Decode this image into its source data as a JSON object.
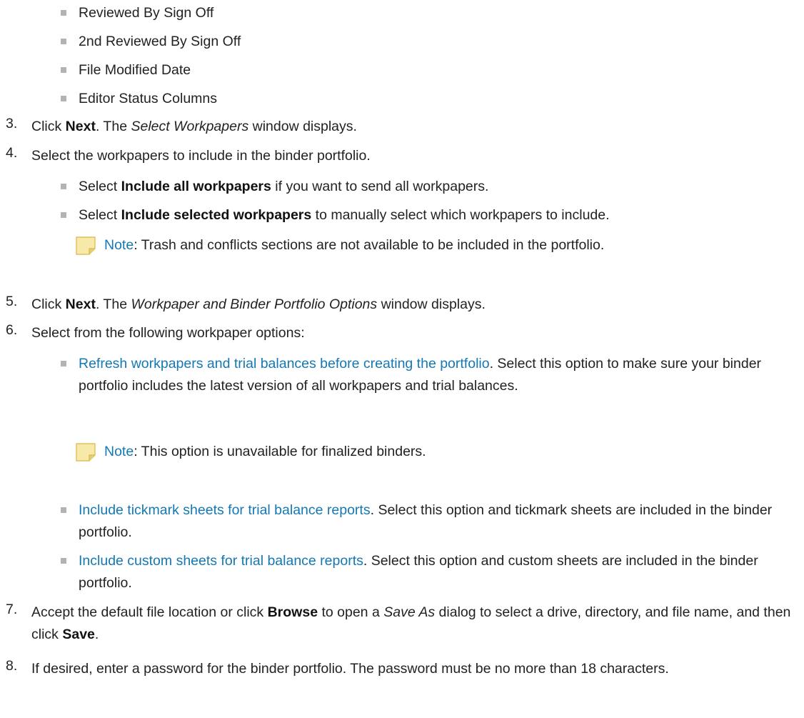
{
  "top_bullets": [
    "Reviewed By Sign Off",
    "2nd Reviewed By Sign Off",
    "File Modified Date",
    "Editor Status Columns"
  ],
  "steps": {
    "s3": {
      "num": "3.",
      "t1": "Click ",
      "b1": "Next",
      "t2": ". The ",
      "i1": "Select Workpapers",
      "t3": " window displays."
    },
    "s4": {
      "num": "4.",
      "text": "Select the workpapers to include in the binder portfolio.",
      "items": [
        {
          "t1": "Select ",
          "b1": "Include all workpapers",
          "t2": " if you want to send all workpapers."
        },
        {
          "t1": "Select ",
          "b1": "Include selected workpapers",
          "t2": " to manually select which workpapers to include."
        }
      ],
      "note": {
        "label": "Note",
        "text": ": Trash and conflicts sections are not available to be included in the portfolio."
      }
    },
    "s5": {
      "num": "5.",
      "t1": "Click ",
      "b1": "Next",
      "t2": ". The ",
      "i1": "Workpaper and Binder Portfolio Options",
      "t3": " window displays."
    },
    "s6": {
      "num": "6.",
      "text": "Select from the following workpaper options:",
      "items": [
        {
          "link": "Refresh workpapers and trial balances before creating the portfolio",
          "text": ". Select this option to make sure your binder portfolio includes the latest version of all workpapers and trial balances."
        },
        {
          "link": "Include tickmark sheets for trial balance reports",
          "text": ". Select this option and tickmark sheets are included in the binder portfolio."
        },
        {
          "link": "Include custom sheets for trial balance reports",
          "text": ". Select this option and custom sheets are included in the binder portfolio."
        }
      ],
      "note": {
        "label": "Note",
        "text": ": This option is unavailable for finalized binders."
      }
    },
    "s7": {
      "num": "7.",
      "t1": "Accept the default file location or click ",
      "b1": "Browse",
      "t2": " to open a ",
      "i1": "Save As",
      "t3": " dialog to select a drive, directory, and file name, and then click ",
      "b2": "Save",
      "t4": "."
    },
    "s8": {
      "num": "8.",
      "text": "If desired, enter a password for the binder portfolio. The password must be no more than 18 characters."
    }
  },
  "colors": {
    "link": "#1478b4",
    "bullet": "#b3b3b3",
    "note_icon": "#f5e6a3"
  },
  "icons": {
    "note": "sticky-note-icon",
    "bullet": "square-bullet-icon"
  }
}
